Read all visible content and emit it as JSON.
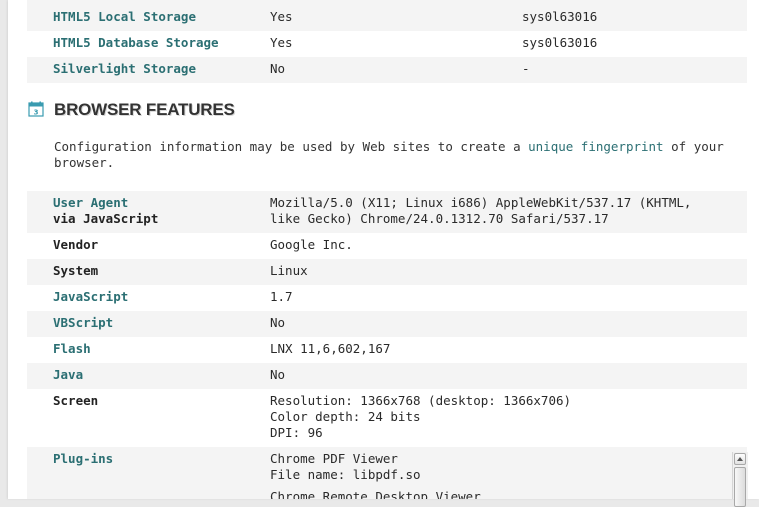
{
  "storage_rows": [
    {
      "label": "HTML5 Local Storage",
      "value": "Yes",
      "extra": "sys0l63016"
    },
    {
      "label": "HTML5 Database Storage",
      "value": "Yes",
      "extra": "sys0l63016"
    },
    {
      "label": "Silverlight Storage",
      "value": "No",
      "extra": "-"
    }
  ],
  "section": {
    "icon": "calendar-icon",
    "title": "BROWSER FEATURES"
  },
  "intro": {
    "before": "Configuration information may be used by Web sites to create a ",
    "link": "unique fingerprint",
    "after": " of your browser."
  },
  "features": {
    "user_agent": {
      "label_line1": "User Agent",
      "label_line2": "via JavaScript",
      "value_line1": "Mozilla/5.0 (X11; Linux i686) AppleWebKit/537.17 (KHTML,",
      "value_line2": "like Gecko) Chrome/24.0.1312.70 Safari/537.17"
    },
    "vendor": {
      "label": "Vendor",
      "value": "Google Inc."
    },
    "system": {
      "label": "System",
      "value": "Linux"
    },
    "javascript": {
      "label": "JavaScript",
      "value": "1.7"
    },
    "vbscript": {
      "label": "VBScript",
      "value": "No"
    },
    "flash": {
      "label": "Flash",
      "value": "LNX 11,6,602,167"
    },
    "java": {
      "label": "Java",
      "value": "No"
    },
    "screen": {
      "label": "Screen",
      "line1": "Resolution: 1366x768 (desktop: 1366x706)",
      "line2": "Color depth: 24 bits",
      "line3": "DPI: 96"
    },
    "plugins": {
      "label": "Plug-ins",
      "line1": "Chrome PDF Viewer",
      "line2": "File name: libpdf.so",
      "line3": "Chrome Remote Desktop Viewer"
    }
  },
  "colors": {
    "link": "#2b6f73",
    "row_shade": "#f4f4f4",
    "icon": "#3a9bb0"
  }
}
